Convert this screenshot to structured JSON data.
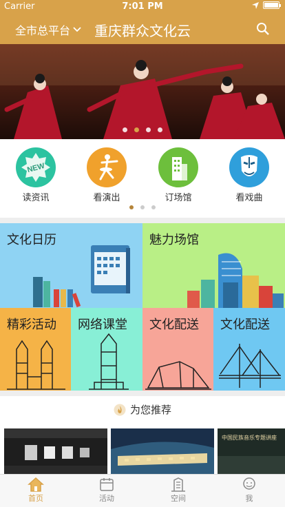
{
  "status": {
    "carrier": "Carrier",
    "time": "7:01 PM"
  },
  "nav": {
    "city": "全市总平台",
    "title": "重庆群众文化云"
  },
  "banner": {
    "dots": 4,
    "active": 1
  },
  "quick_icons": [
    {
      "label": "读资讯",
      "icon": "new-badge-icon",
      "color": "#2cc3a0"
    },
    {
      "label": "看演出",
      "icon": "ballet-dancer-icon",
      "color": "#f0a12c"
    },
    {
      "label": "订场馆",
      "icon": "building-icon",
      "color": "#6dbf3c"
    },
    {
      "label": "看戏曲",
      "icon": "opera-mask-icon",
      "color": "#2f9fdb"
    }
  ],
  "page_dots": {
    "count": 3,
    "active": 0
  },
  "tiles": {
    "calendar": {
      "label": "文化日历",
      "color": "#8fd3f3"
    },
    "venue": {
      "label": "魅力场馆",
      "color": "#b9ef86"
    },
    "activity": {
      "label": "精彩活动",
      "color": "#f5b347"
    },
    "course": {
      "label": "网络课堂",
      "color": "#88efd6"
    },
    "delivery1": {
      "label": "文化配送",
      "color": "#f7a598"
    },
    "delivery2": {
      "label": "文化配送",
      "color": "#6fc8f2"
    }
  },
  "recommend": {
    "label": "为您推荐"
  },
  "tabs": [
    {
      "label": "首页",
      "icon": "home-icon",
      "active": true
    },
    {
      "label": "活动",
      "icon": "calendar-icon",
      "active": false
    },
    {
      "label": "空间",
      "icon": "building-icon",
      "active": false
    },
    {
      "label": "我",
      "icon": "user-icon",
      "active": false
    }
  ],
  "thumb3_text": "中国民族音乐专题讲座"
}
